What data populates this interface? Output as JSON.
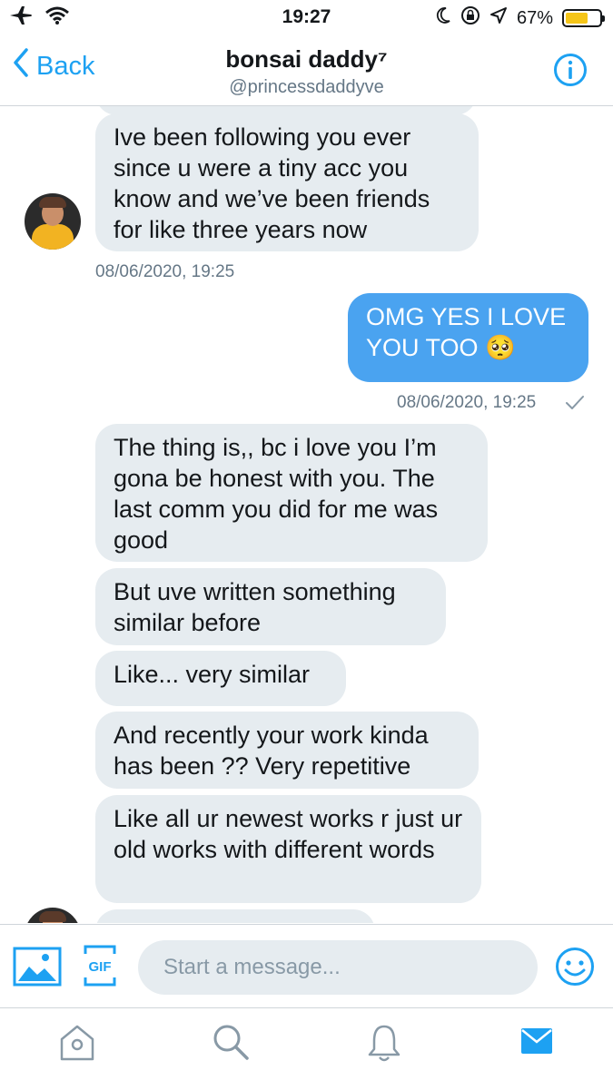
{
  "status_bar": {
    "time": "19:27",
    "battery": "67%",
    "battery_level": 0.67
  },
  "header": {
    "back_label": "Back",
    "name": "bonsai daddy⁷",
    "handle": "@princessdaddyve"
  },
  "messages": [
    {
      "direction": "in",
      "text": "Ive been following you ever since u were a tiny acc you know and we’ve been friends for like three years now"
    },
    {
      "direction": "in",
      "timestamp": "08/06/2020, 19:25"
    },
    {
      "direction": "out",
      "text": "OMG YES I LOVE YOU TOO 🥺",
      "timestamp": "08/06/2020, 19:25",
      "status": "sent"
    },
    {
      "direction": "in",
      "text": "The thing is,, bc i love you I’m gona be honest with you. The last comm you did for me was good"
    },
    {
      "direction": "in",
      "text": "But uve written something similar before"
    },
    {
      "direction": "in",
      "text": "Like... very similar"
    },
    {
      "direction": "in",
      "text": "And recently your work kinda has been ?? Very repetitive"
    },
    {
      "direction": "in",
      "text": "Like all ur newest works r just ur old works with different words"
    }
  ],
  "composer": {
    "placeholder": "Start a message..."
  },
  "tab_bar": {
    "items": [
      "home",
      "search",
      "notifications",
      "messages"
    ],
    "active": "messages"
  },
  "colors": {
    "accent": "#1da1f2",
    "outgoing_bubble": "#4aa3f0",
    "incoming_bubble": "#e6ecf0",
    "muted_text": "#657786"
  }
}
